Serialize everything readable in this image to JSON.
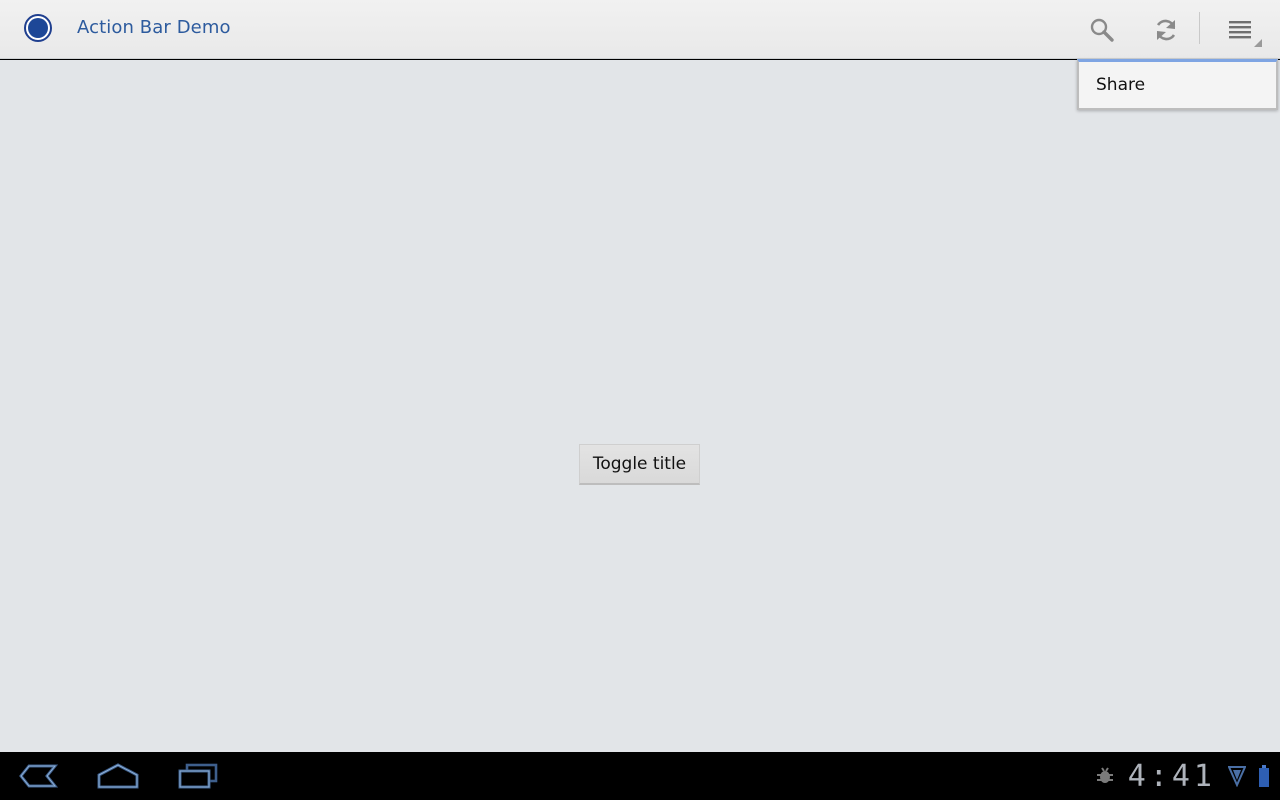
{
  "app": {
    "title": "Action Bar Demo",
    "icon": "app-circle-icon",
    "accent_color": "#2d5b9e"
  },
  "action_bar": {
    "actions": [
      {
        "name": "search",
        "icon": "search-icon"
      },
      {
        "name": "refresh",
        "icon": "refresh-icon"
      },
      {
        "name": "overflow",
        "icon": "overflow-menu-icon"
      }
    ]
  },
  "popup_menu": {
    "items": [
      {
        "label": "Share"
      }
    ]
  },
  "content": {
    "toggle_button_label": "Toggle title"
  },
  "system_bar": {
    "nav": [
      {
        "name": "back",
        "icon": "back-icon"
      },
      {
        "name": "home",
        "icon": "home-icon"
      },
      {
        "name": "recent-apps",
        "icon": "recent-apps-icon"
      }
    ],
    "clock": "4:41",
    "status_icons": [
      "debug-bug-icon",
      "signal-icon",
      "battery-icon"
    ]
  }
}
